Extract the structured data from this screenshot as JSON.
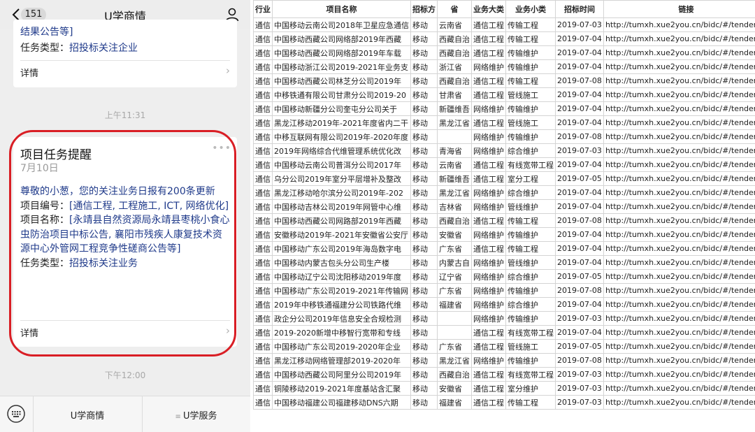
{
  "phone": {
    "badge": "151",
    "title": "U学商情",
    "card1": {
      "text_top": "结果公告等]",
      "type_label": "任务类型：",
      "type_value": "招投标关注企业",
      "detail": "详情"
    },
    "time1": "上午11:31",
    "card2": {
      "heading": "项目任务提醒",
      "date": "7月10日",
      "greeting": "尊敬的小葱，您的关注业务日报有200条更新",
      "code_label": "项目编号：",
      "code_value": "[通信工程, 工程施工, ICT, 网络优化]",
      "name_label": "项目名称：",
      "name_value": "[永靖县自然资源局永靖县枣桃小食心虫防治项目中标公告, 襄阳市残疾人康复技术资源中心外管网工程竞争性磋商公告等]",
      "type_label": "任务类型：",
      "type_value": "招投标关注业务",
      "detail": "详情"
    },
    "time2": "下午12:00",
    "menu": [
      "U学商情",
      "U学服务"
    ]
  },
  "table": {
    "headers": [
      "行业",
      "项目名称",
      "招标方",
      "省",
      "业务大类",
      "业务小类",
      "招标时间",
      "链接"
    ],
    "rows": [
      [
        "通信",
        "中国移动云南公司2018年卫星应急通信",
        "移动",
        "云南省",
        "通信工程",
        "传输工程",
        "2019-07-03",
        "http://tumxh.xue2you.cn/bidc/#/tender/te"
      ],
      [
        "通信",
        "中国移动西藏公司网络部2019年西藏",
        "移动",
        "西藏自治",
        "通信工程",
        "传输工程",
        "2019-07-04",
        "http://tumxh.xue2you.cn/bidc/#/tender/te"
      ],
      [
        "通信",
        "中国移动西藏公司网络部2019年车载",
        "移动",
        "西藏自治",
        "通信工程",
        "传输维护",
        "2019-07-04",
        "http://tumxh.xue2you.cn/bidc/#/tender/te"
      ],
      [
        "通信",
        "中国移动浙江公司2019-2021年业务支",
        "移动",
        "浙江省",
        "网络维护",
        "传输维护",
        "2019-07-04",
        "http://tumxh.xue2you.cn/bidc/#/tender/te"
      ],
      [
        "通信",
        "中国移动西藏公司林芝分公司2019年",
        "移动",
        "西藏自治",
        "通信工程",
        "传输工程",
        "2019-07-08",
        "http://tumxh.xue2you.cn/bidc/#/tender/te"
      ],
      [
        "通信",
        "中移铁通有限公司甘肃分公司2019-20",
        "移动",
        "甘肃省",
        "通信工程",
        "管线施工",
        "2019-07-04",
        "http://tumxh.xue2you.cn/bidc/#/tender/te"
      ],
      [
        "通信",
        "中国移动新疆分公司奎屯分公司关于",
        "移动",
        "新疆维吾",
        "网络维护",
        "传输维护",
        "2019-07-04",
        "http://tumxh.xue2you.cn/bidc/#/tender/te"
      ],
      [
        "通信",
        "黑龙江移动2019年-2021年度省内二干",
        "移动",
        "黑龙江省",
        "通信工程",
        "管线施工",
        "2019-07-04",
        "http://tumxh.xue2you.cn/bidc/#/tender/te"
      ],
      [
        "通信",
        "中移互联网有限公司2019年-2020年度",
        "移动",
        "",
        "网络维护",
        "传输维护",
        "2019-07-08",
        "http://tumxh.xue2you.cn/bidc/#/tender/te"
      ],
      [
        "通信",
        "2019年网络综合代维管理系统优化改",
        "移动",
        "青海省",
        "网络维护",
        "综合维护",
        "2019-07-03",
        "http://tumxh.xue2you.cn/bidc/#/tender/te"
      ],
      [
        "通信",
        "中国移动云南公司普洱分公司2017年",
        "移动",
        "云南省",
        "通信工程",
        "有线宽带工程",
        "2019-07-04",
        "http://tumxh.xue2you.cn/bidc/#/tender/te"
      ],
      [
        "通信",
        "乌分公司2019年室分平层增补及整改",
        "移动",
        "新疆维吾",
        "通信工程",
        "室分工程",
        "2019-07-05",
        "http://tumxh.xue2you.cn/bidc/#/tender/te"
      ],
      [
        "通信",
        "黑龙江移动哈尔滨分公司2019年-202",
        "移动",
        "黑龙江省",
        "网络维护",
        "综合维护",
        "2019-07-04",
        "http://tumxh.xue2you.cn/bidc/#/tender/te"
      ],
      [
        "通信",
        "中国移动吉林公司2019年网管中心维",
        "移动",
        "吉林省",
        "网络维护",
        "管线维护",
        "2019-07-04",
        "http://tumxh.xue2you.cn/bidc/#/tender/te"
      ],
      [
        "通信",
        "中国移动西藏公司网路部2019年西藏",
        "移动",
        "西藏自治",
        "通信工程",
        "传输工程",
        "2019-07-08",
        "http://tumxh.xue2you.cn/bidc/#/tender/te"
      ],
      [
        "通信",
        "安徽移动2019年-2021年安徽省公安厅",
        "移动",
        "安徽省",
        "网络维护",
        "传输维护",
        "2019-07-04",
        "http://tumxh.xue2you.cn/bidc/#/tender/te"
      ],
      [
        "通信",
        "中国移动广东公司2019年海岛数字电",
        "移动",
        "广东省",
        "通信工程",
        "传输工程",
        "2019-07-04",
        "http://tumxh.xue2you.cn/bidc/#/tender/te"
      ],
      [
        "通信",
        "中国移动内蒙古包头分公司生产楼",
        "移动",
        "内蒙古自",
        "网络维护",
        "管线维护",
        "2019-07-04",
        "http://tumxh.xue2you.cn/bidc/#/tender/te"
      ],
      [
        "通信",
        "中国移动辽宁公司沈阳移动2019年度",
        "移动",
        "辽宁省",
        "网络维护",
        "综合维护",
        "2019-07-05",
        "http://tumxh.xue2you.cn/bidc/#/tender/te"
      ],
      [
        "通信",
        "中国移动广东公司2019-2021年传输网",
        "移动",
        "广东省",
        "网络维护",
        "传输维护",
        "2019-07-08",
        "http://tumxh.xue2you.cn/bidc/#/tender/te"
      ],
      [
        "通信",
        "2019年中移铁通福建分公司铁路代维",
        "移动",
        "福建省",
        "网络维护",
        "综合维护",
        "2019-07-04",
        "http://tumxh.xue2you.cn/bidc/#/tender/te"
      ],
      [
        "通信",
        "政企分公司2019年信息安全合规检测",
        "移动",
        "",
        "网络维护",
        "传输维护",
        "2019-07-03",
        "http://tumxh.xue2you.cn/bidc/#/tender/te"
      ],
      [
        "通信",
        "2019-2020新增中移智行宽带和专线",
        "移动",
        "",
        "通信工程",
        "有线宽带工程",
        "2019-07-04",
        "http://tumxh.xue2you.cn/bidc/#/tender/te"
      ],
      [
        "通信",
        "中国移动广东公司2019-2020年企业",
        "移动",
        "广东省",
        "通信工程",
        "管线施工",
        "2019-07-05",
        "http://tumxh.xue2you.cn/bidc/#/tender/te"
      ],
      [
        "通信",
        "黑龙江移动网络管理部2019-2020年",
        "移动",
        "黑龙江省",
        "网络维护",
        "传输维护",
        "2019-07-08",
        "http://tumxh.xue2you.cn/bidc/#/tender/te"
      ],
      [
        "通信",
        "中国移动西藏公司阿里分公司2019年",
        "移动",
        "西藏自治",
        "通信工程",
        "有线宽带工程",
        "2019-07-03",
        "http://tumxh.xue2you.cn/bidc/#/tender/te"
      ],
      [
        "通信",
        "铜陵移动2019-2021年度基站含汇聚",
        "移动",
        "安徽省",
        "通信工程",
        "室分维护",
        "2019-07-03",
        "http://tumxh.xue2you.cn/bidc/#/tender/te"
      ],
      [
        "通信",
        "中国移动福建公司福建移动DNS六期",
        "移动",
        "福建省",
        "通信工程",
        "传输工程",
        "2019-07-03",
        "http://tumxh.xue2you.cn/bidc/#/tender/te"
      ]
    ]
  }
}
